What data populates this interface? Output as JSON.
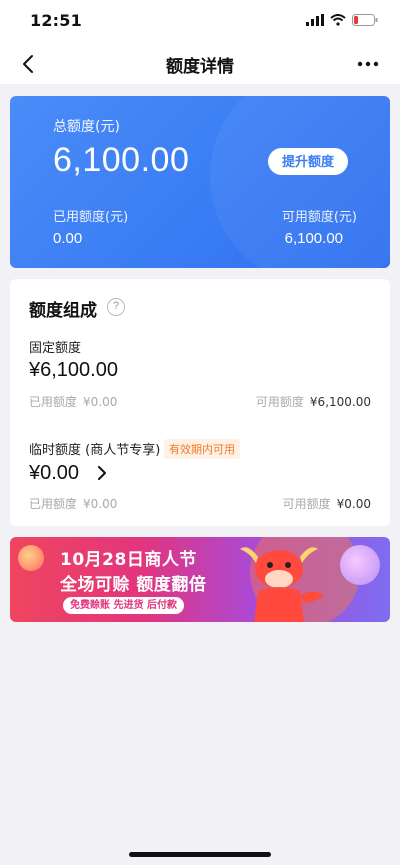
{
  "status": {
    "time": "12:51"
  },
  "nav": {
    "title": "额度详情"
  },
  "summary": {
    "total_label": "总额度(元)",
    "total_amount": "6,100.00",
    "raise_button": "提升额度",
    "used_label": "已用额度(元)",
    "used_value": "0.00",
    "available_label": "可用额度(元)",
    "available_value": "6,100.00"
  },
  "composition": {
    "title": "额度组成",
    "fixed": {
      "label": "固定额度",
      "amount": "¥6,100.00",
      "used_label": "已用额度",
      "used_value": "¥0.00",
      "available_label": "可用额度",
      "available_value": "¥6,100.00"
    },
    "temporary": {
      "label": "临时额度 (商人节专享)",
      "tag": "有效期内可用",
      "amount": "¥0.00",
      "used_label": "已用额度",
      "used_value": "¥0.00",
      "available_label": "可用额度",
      "available_value": "¥0.00"
    }
  },
  "banner": {
    "line1": "10月28日商人节",
    "line2": "全场可赊 额度翻倍",
    "pill": "免费赊账 先进货 后付款"
  },
  "colors": {
    "accent": "#3a7df4",
    "tag": "#f07b2a"
  }
}
